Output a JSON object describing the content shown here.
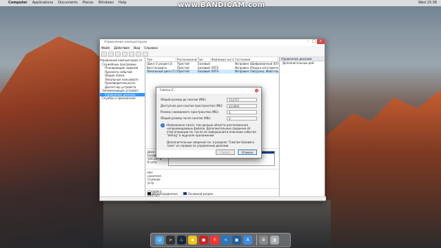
{
  "menubar": {
    "app": "Computer",
    "items": [
      "Applications",
      "Documents",
      "Places",
      "Windows",
      "Help"
    ],
    "clock": "Wed 15:38"
  },
  "watermark": "www.BANDICAM.com",
  "window": {
    "title": "Управление компьютером",
    "menu": [
      "Файл",
      "Действие",
      "Вид",
      "Справка"
    ],
    "tree": [
      "Управление компьютером (л",
      "Служебные программы",
      "Планировщик заданий",
      "Просмотр событий",
      "Общие папки",
      "Локальные пользовате",
      "Производительность",
      "Диспетчер устройств",
      "Запоминающие устройст",
      "Управление дисками",
      "Службы и приложения"
    ],
    "columns": [
      "Том",
      "Расположение",
      "Тип",
      "Файловая система",
      "Состояние"
    ],
    "rows": [
      [
        "(Диск 0 раздел 2)",
        "Простой",
        "Базовый",
        "",
        "Исправен (Шифрованный (EFI) с"
      ],
      [
        "Восстановить",
        "Простой",
        "Базовый",
        "NTFS",
        "Исправен (Раздел изготовителя о"
      ],
      [
        "Локальный диск (C:)",
        "Простой",
        "Базовый",
        "NTFS",
        "Исправен (Загрузка, Файл подк"
      ]
    ],
    "disks": [
      {
        "label": "Диск 0",
        "sub": "Базовый",
        "size": "500,10 ГБ",
        "state": "В сети"
      },
      {
        "label": "Нет носителя",
        "sub": "Съемное устр",
        "size": "",
        "state": ""
      },
      {
        "label": "CD-ROM 0",
        "sub": "DVD (D:)",
        "size": "",
        "state": "Нет носителя"
      }
    ],
    "legend": [
      "Не распределена",
      "Основной раздел"
    ],
    "actions": {
      "header": "Управление дисками",
      "item": "Дополнительные дей"
    }
  },
  "dialog": {
    "title": "Сжать C:",
    "fields": [
      {
        "label": "Общий размер до сжатия (МБ):",
        "value": "714757"
      },
      {
        "label": "Доступное для сжатия пространство (МБ):",
        "value": "410896"
      },
      {
        "label": "Размер сжимаемого пространства (МБ):",
        "value": "1"
      },
      {
        "label": "Общий размер после сжатия (МБ):",
        "value": "0"
      }
    ],
    "info": "Невозможно сжать том дальше области расположения неперемещаемых файлов. Дополнительные сведения об этой операции см. после ее завершения в описании события \"defrag\" в журнале приложений.",
    "note": "Дополнительные сведения см. в разделе \"Сжатие базового тома\" из справки по управлению дисками",
    "ok": "Сжать",
    "cancel": "Отмена"
  },
  "dock": {
    "icons": [
      "finder-icon",
      "terminal-icon",
      "steam-icon",
      "chrome-icon",
      "record-icon",
      "yandex-icon",
      "vscode-icon",
      "virtualbox-icon",
      "appstore-icon",
      "settings-icon",
      "trash-icon"
    ]
  }
}
